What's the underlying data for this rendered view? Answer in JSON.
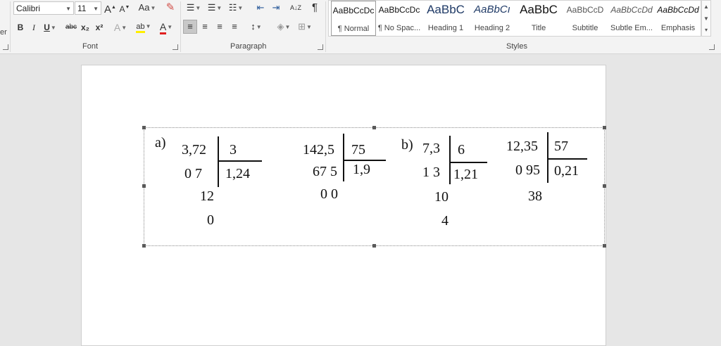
{
  "font": {
    "name_value": "Calibri",
    "size_value": "11",
    "grow_label": "A",
    "shrink_label": "A",
    "case_label": "Aa",
    "bold": "B",
    "italic": "I",
    "underline": "U",
    "strike": "abc",
    "subscript": "x₂",
    "superscript": "x²",
    "effects": "A",
    "highlight": "ab",
    "color": "A",
    "label": "Font"
  },
  "paragraph": {
    "label": "Paragraph",
    "sort": "A↓Z",
    "pilcrow": "¶"
  },
  "styles": {
    "label": "Styles",
    "items": [
      {
        "sample": "AaBbCcDc",
        "name": "¶ Normal"
      },
      {
        "sample": "AaBbCcDc",
        "name": "¶ No Spac..."
      },
      {
        "sample": "AaBbC",
        "name": "Heading 1"
      },
      {
        "sample": "AaBbCı",
        "name": "Heading 2"
      },
      {
        "sample": "AaBbC",
        "name": "Title"
      },
      {
        "sample": "AaBbCcD",
        "name": "Subtitle"
      },
      {
        "sample": "AaBbCcDd",
        "name": "Subtle Em..."
      },
      {
        "sample": "AaBbCcDd",
        "name": "Emphasis"
      }
    ]
  },
  "clipboard_fragment": "er",
  "math": {
    "a_label": "a)",
    "b_label": "b)",
    "d1": {
      "dividend": "3,72",
      "divisor": "3",
      "quotient": "1,24",
      "r1": "0 7",
      "r2": "12",
      "r3": "0"
    },
    "d2": {
      "dividend": "142,5",
      "divisor": "75",
      "quotient": "1,9",
      "r1": "67 5",
      "r2": "0 0"
    },
    "d3": {
      "dividend": "7,3",
      "divisor": "6",
      "quotient": "1,21",
      "r1": "1 3",
      "r2": "10",
      "r3": "4"
    },
    "d4": {
      "dividend": "12,35",
      "divisor": "57",
      "quotient": "0,21",
      "r1": "0 95",
      "r2": "38"
    }
  }
}
